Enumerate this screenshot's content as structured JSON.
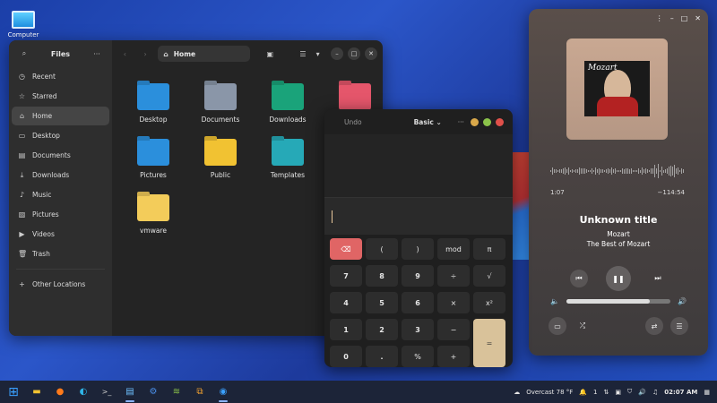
{
  "desktop": {
    "icons": [
      {
        "label": "Computer",
        "icon": "monitor-icon"
      }
    ]
  },
  "files": {
    "title": "Files",
    "sidebar": [
      {
        "label": "Recent",
        "icon": "clock-icon",
        "active": false
      },
      {
        "label": "Starred",
        "icon": "star-icon",
        "active": false
      },
      {
        "label": "Home",
        "icon": "home-icon",
        "active": true
      },
      {
        "label": "Desktop",
        "icon": "desktop-icon",
        "active": false
      },
      {
        "label": "Documents",
        "icon": "document-icon",
        "active": false
      },
      {
        "label": "Downloads",
        "icon": "download-icon",
        "active": false
      },
      {
        "label": "Music",
        "icon": "music-icon",
        "active": false
      },
      {
        "label": "Pictures",
        "icon": "picture-icon",
        "active": false
      },
      {
        "label": "Videos",
        "icon": "video-icon",
        "active": false
      },
      {
        "label": "Trash",
        "icon": "trash-icon",
        "active": false
      }
    ],
    "other_locations": "Other Locations",
    "path": "Home",
    "folders": [
      {
        "label": "Desktop",
        "color": "#2b8fdc"
      },
      {
        "label": "Documents",
        "color": "#8a96a8"
      },
      {
        "label": "Downloads",
        "color": "#1aa37a"
      },
      {
        "label": "",
        "color": "#e5566b"
      },
      {
        "label": "Pictures",
        "color": "#2b8fdc"
      },
      {
        "label": "Public",
        "color": "#f1c232"
      },
      {
        "label": "Templates",
        "color": "#26a9b7"
      },
      {
        "label": "vmware",
        "color": "#f3cc5a"
      }
    ]
  },
  "calculator": {
    "undo": "Undo",
    "mode": "Basic",
    "rows": [
      [
        "⌫",
        "(",
        ")",
        "mod",
        "π"
      ],
      [
        "7",
        "8",
        "9",
        "÷",
        "√"
      ],
      [
        "4",
        "5",
        "6",
        "×",
        "x²"
      ],
      [
        "1",
        "2",
        "3",
        "−",
        "="
      ],
      [
        "0",
        ".",
        "%",
        "+"
      ]
    ],
    "colors": {
      "delete": "#e06565",
      "equals": "#d9c29a",
      "minimize": "#d9a84a",
      "maximize": "#8bc34a",
      "close": "#e0504a"
    }
  },
  "music": {
    "album_title": "Mozart",
    "elapsed": "1:07",
    "remaining": "−114:54",
    "title": "Unknown title",
    "artist": "Mozart",
    "album": "The Best of Mozart",
    "volume": 0.8
  },
  "taskbar": {
    "weather": "Overcast 78 °F",
    "notification_count": "1",
    "time": "02:07 AM"
  }
}
